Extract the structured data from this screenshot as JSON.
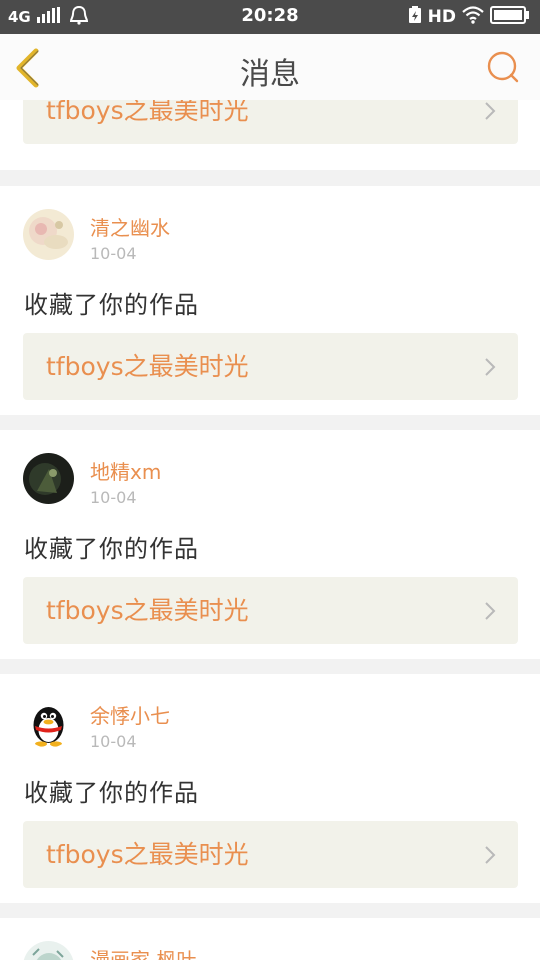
{
  "status_bar": {
    "network": "4G",
    "time": "20:28",
    "hd": "HD"
  },
  "header": {
    "title": "消息"
  },
  "notifications": [
    {
      "user": "",
      "date": "",
      "action": "",
      "work_title": "tfboys之最美时光"
    },
    {
      "user": "清之幽水",
      "date": "10-04",
      "action": "收藏了你的作品",
      "work_title": "tfboys之最美时光"
    },
    {
      "user": "地精xm",
      "date": "10-04",
      "action": "收藏了你的作品",
      "work_title": "tfboys之最美时光"
    },
    {
      "user": "余悸小七",
      "date": "10-04",
      "action": "收藏了你的作品",
      "work_title": "tfboys之最美时光"
    },
    {
      "user": "漫画家 枫叶",
      "date": "",
      "action": "",
      "work_title": ""
    }
  ],
  "colors": {
    "accent": "#e98f4f",
    "back_arrow": "#e2b52a",
    "status_bar_bg": "#4b4b4b",
    "work_box_bg": "#f2f2ea"
  }
}
